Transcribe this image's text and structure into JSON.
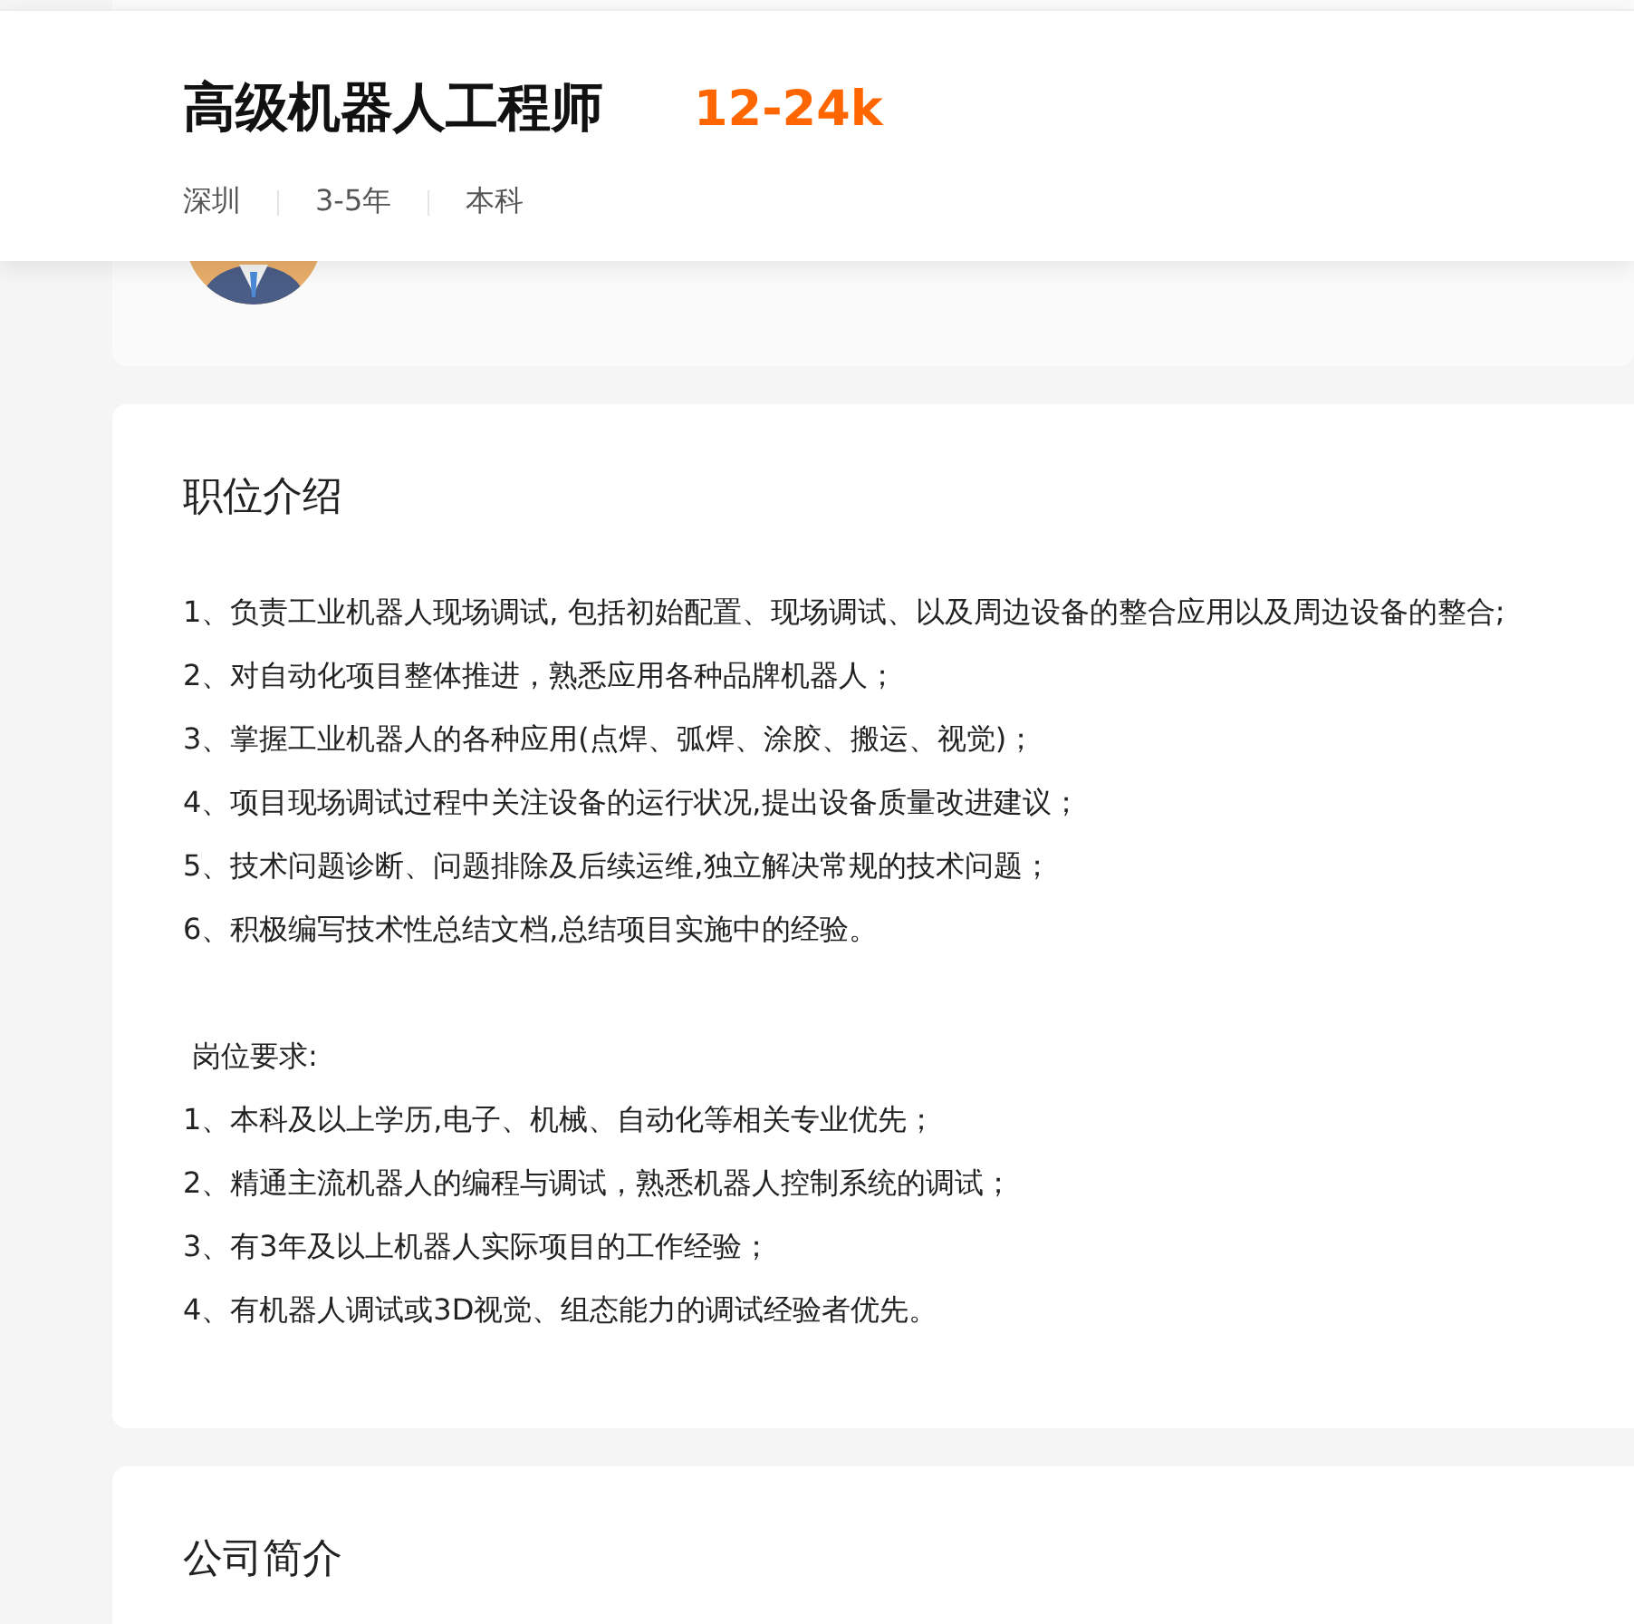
{
  "header": {
    "title": "高级机器人工程师",
    "salary": "12-24k",
    "tags": [
      "深圳",
      "3-5年",
      "本科"
    ]
  },
  "sections": [
    {
      "title": "职位介绍",
      "blocks": [
        {
          "lines": [
            "1、负责工业机器人现场调试, 包括初始配置、现场调试、以及周边设备的整合应用以及周边设备的整合;",
            "2、对自动化项目整体推进，熟悉应用各种品牌机器人；",
            "3、掌握工业机器人的各种应用(点焊、弧焊、涂胶、搬运、视觉)；",
            "4、项目现场调试过程中关注设备的运行状况,提出设备质量改进建议；",
            "5、技术问题诊断、问题排除及后续运维,独立解决常规的技术问题；",
            "6、积极编写技术性总结文档,总结项目实施中的经验。"
          ]
        },
        {
          "heading": "岗位要求:",
          "lines": [
            "1、本科及以上学历,电子、机械、自动化等相关专业优先；",
            "2、精通主流机器人的编程与调试，熟悉机器人控制系统的调试；",
            "3、有3年及以上机器人实际项目的工作经验；",
            "4、有机器人调试或3D视觉、组态能力的调试经验者优先。"
          ]
        }
      ]
    },
    {
      "title": "公司简介"
    }
  ]
}
